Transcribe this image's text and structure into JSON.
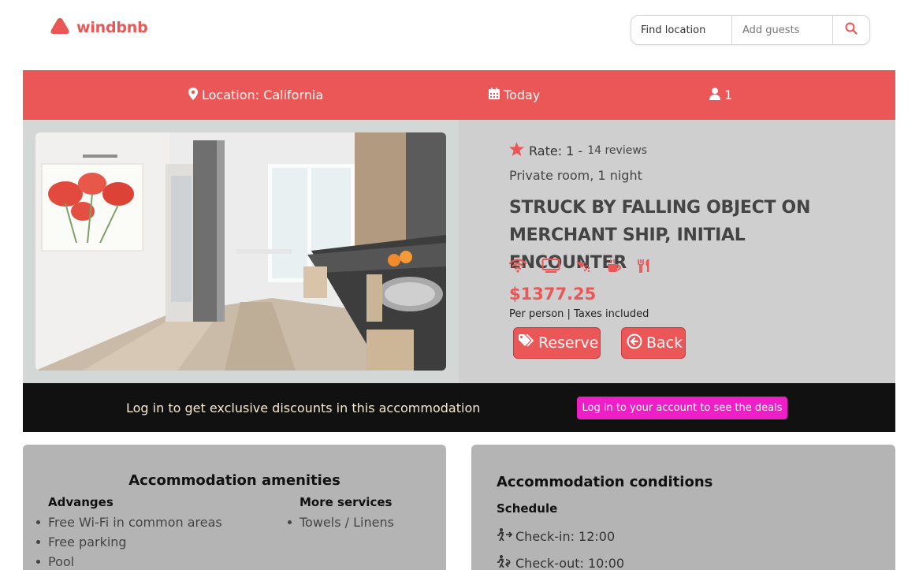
{
  "brand": {
    "name": "windbnb",
    "color": "#eb5757",
    "logo_icon": "triangle-logo-icon"
  },
  "search": {
    "location_label": "Find location",
    "guests_placeholder": "Add guests",
    "button_icon": "search-icon"
  },
  "summary_bar": {
    "location": "Location: California",
    "date": "Today",
    "guests": "1"
  },
  "listing": {
    "rate_label": "Rate: 1 -",
    "reviews": "14 reviews",
    "room_type": "Private room, 1 night",
    "title": "STRUCK BY FALLING OBJECT ON MERCHANT SHIP, INITIAL ENCOUNTER",
    "amenity_icons": [
      "wifi-icon",
      "tv-icon",
      "shower-icon",
      "coffee-icon",
      "utensils-icon"
    ],
    "price": "$1377.25",
    "price_note": "Per person | Taxes included",
    "reserve_label": "Reserve",
    "back_label": "Back"
  },
  "promo": {
    "message": "Log in to get exclusive discounts in this accommodation",
    "button_label": "Log in to your account to see the deals",
    "button_color": "#ee1fc6"
  },
  "amenities": {
    "title": "Accommodation amenities",
    "col1_title": "Advanges",
    "col1_items": [
      "Free Wi-Fi in common areas",
      "Free parking",
      "Pool"
    ],
    "col2_title": "More services",
    "col2_items": [
      "Towels / Linens"
    ]
  },
  "conditions": {
    "title": "Accommodation conditions",
    "schedule_title": "Schedule",
    "check_in": "Check-in: 12:00",
    "check_out": "Check-out: 10:00"
  }
}
